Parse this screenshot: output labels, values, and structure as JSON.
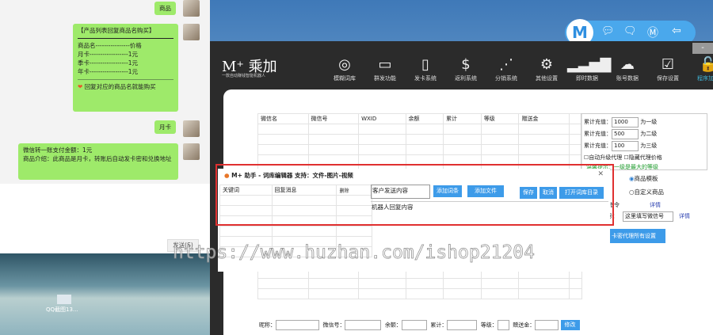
{
  "chat": {
    "msg1": "商品",
    "product_list": {
      "title": "【产品列表回复商品名购买】",
      "header": "商品名----------------价格",
      "rows": [
        "月卡------------------1元",
        "季卡------------------1元",
        "年卡------------------1元"
      ],
      "footer": "回复对应的商品名就能购买"
    },
    "msg3": "月卡",
    "msg4_line1": "微信转一账支付金额：1元",
    "msg4_line2": "商品介绍：此商品是月卡，转账后自动发卡密和兑换地址",
    "send_button": "发送(S)",
    "desktop_icon_label": "QQ截图13..."
  },
  "app": {
    "logo": "M⁺ 乘加",
    "logo_sub": "一款自动赚钱智能机器人",
    "minimize": "-",
    "toolbar": [
      {
        "icon": "globe-icon",
        "glyph": "◎",
        "label": "模糊词库"
      },
      {
        "icon": "chat-icon",
        "glyph": "▭",
        "label": "群发功能"
      },
      {
        "icon": "card-icon",
        "glyph": "▯",
        "label": "发卡系统"
      },
      {
        "icon": "dollar-icon",
        "glyph": "$",
        "label": "返利系统"
      },
      {
        "icon": "share-icon",
        "glyph": "⋰",
        "label": "分销系统"
      },
      {
        "icon": "gear-icon",
        "glyph": "⚙",
        "label": "其他设置"
      },
      {
        "icon": "bars-icon",
        "glyph": "▂▃▅▇",
        "label": "即时数据"
      },
      {
        "icon": "cloud-icon",
        "glyph": "☁",
        "label": "账号数据"
      },
      {
        "icon": "save-icon",
        "glyph": "☑",
        "label": "保存设置"
      },
      {
        "icon": "lock-icon",
        "glyph": "🔓",
        "label": "程序加密"
      }
    ],
    "table_headers": [
      "微信名",
      "微信号",
      "WXID",
      "余额",
      "累计",
      "等级",
      "赠送金",
      ""
    ],
    "levels": [
      {
        "label": "累计充值：",
        "value": "1000",
        "suffix": "为一级"
      },
      {
        "label": "累计充值：",
        "value": "500",
        "suffix": "为二级"
      },
      {
        "label": "累计充值：",
        "value": "100",
        "suffix": "为三级"
      }
    ],
    "auto_upgrade": "自动升级代理",
    "hide_price": "隐藏代理价格",
    "tip": "温馨提示：一级是最大的等级",
    "radio_template": "商品模板",
    "radio_custom": "自定义商品",
    "cmd_label": "指令",
    "detail1": "详情",
    "wx_label": "号：",
    "wx_input": "这里填写微信号",
    "detail2": "详情",
    "agent_settings": "卡密代理所有设置",
    "bottom": {
      "nickname": "昵称：",
      "wxid": "微信号：",
      "balance": "余额：",
      "total": "累计：",
      "level": "等级：",
      "gift": "赠送金：",
      "modify": "修改"
    }
  },
  "dialog": {
    "title": "M+ 助手 - 词库编辑器  支持：文件-图片-视频",
    "close": "✕",
    "col1": "关键词",
    "col2": "回复消息",
    "col3": "删除",
    "customer_placeholder": "客户发送内容",
    "add_entry": "添加词条",
    "add_file": "添加文件",
    "save": "保存",
    "cancel": "取消",
    "open_dir": "打开词库目录",
    "robot_reply": "机器人回复内容"
  },
  "watermark": "https://www.huzhan.com/ishop21204",
  "colors": {
    "accent": "#3d9be9",
    "bubble": "#9eea6a",
    "highlight": "#e03030"
  }
}
